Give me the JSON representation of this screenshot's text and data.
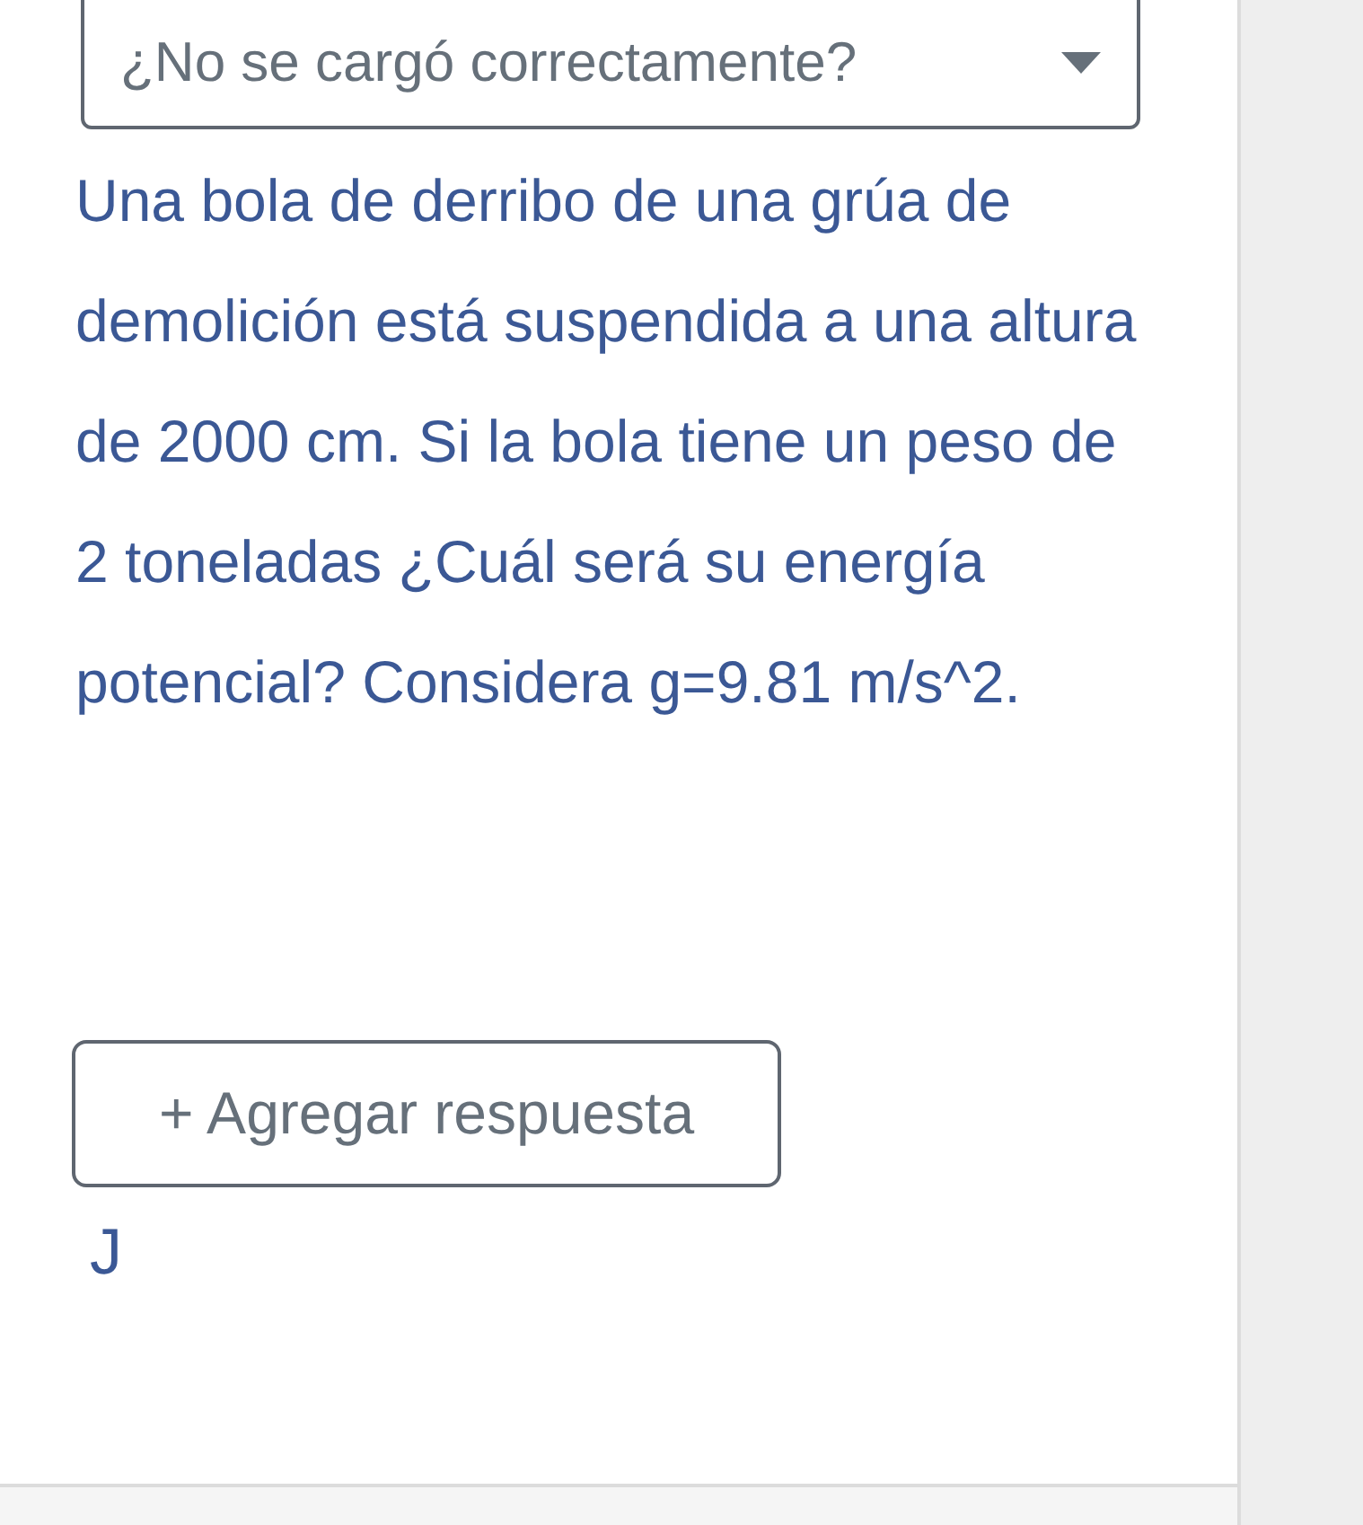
{
  "dropdown": {
    "label": "¿No se cargó correctamente?"
  },
  "question": "Una bola de derribo de una grúa de demolición está suspendida a una altura de 2000 cm. Si la bola tiene un peso de 2 toneladas ¿Cuál será su energía potencial? Considera g=9.81 m/s^2.",
  "add_answer_button": "+ Agregar respuesta",
  "answer_initial": "J"
}
